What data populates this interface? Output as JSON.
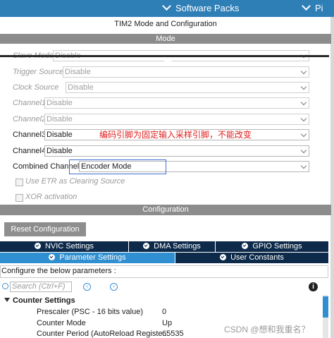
{
  "topbar": {
    "software_packs": "Software Packs",
    "pinout_partial": "Pi"
  },
  "title": "TIM2 Mode and Configuration",
  "mode_header": "Mode",
  "mode_rows": [
    {
      "label": "Slave Mode",
      "value": "Disable",
      "disabled": true
    },
    {
      "label": "Trigger Source",
      "value": "Disable",
      "disabled": true
    },
    {
      "label": "Clock Source",
      "value": "Disable",
      "disabled": true
    },
    {
      "label": "Channel1",
      "value": "Disable",
      "disabled": true
    },
    {
      "label": "Channel2",
      "value": "Disable",
      "disabled": true
    },
    {
      "label": "Channel3",
      "value": "Disable",
      "disabled": false
    },
    {
      "label": "Channel4",
      "value": "Disable",
      "disabled": false
    },
    {
      "label": "Combined Channels",
      "value": "Encoder Mode",
      "disabled": false
    }
  ],
  "checkboxes": [
    {
      "label": "Use ETR as Clearing Source"
    },
    {
      "label": "XOR activation"
    }
  ],
  "annotation": "编码引脚为固定输入采样引脚，不能改变",
  "config_header": "Configuration",
  "reset_button": "Reset Configuration",
  "tabs_row1": [
    "NVIC Settings",
    "DMA Settings",
    "GPIO Settings"
  ],
  "tabs_row2": [
    "Parameter Settings",
    "User Constants"
  ],
  "params_label": "Configure the below parameters :",
  "search_placeholder": "Search (Ctrl+F)",
  "counter_group": "Counter Settings",
  "params": [
    {
      "label": "Prescaler (PSC - 16 bits value)",
      "value": "0"
    },
    {
      "label": "Counter Mode",
      "value": "Up"
    },
    {
      "label": "Counter Period (AutoReload Registe...",
      "value": "65535"
    }
  ],
  "watermark": "CSDN @想和我重名？",
  "colors": {
    "accent": "#2f7fb7",
    "tab_dark": "#0d2a4a",
    "tab_light": "#2f8fd0",
    "annotation": "#e02020",
    "highlight": "#3a6fd0"
  }
}
